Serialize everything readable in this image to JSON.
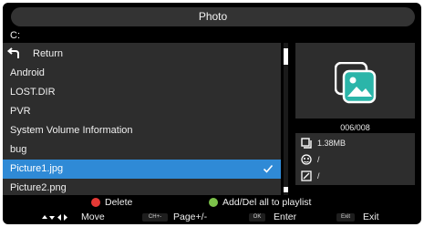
{
  "title": "Photo",
  "path": "C:",
  "file_list": {
    "return_label": "Return",
    "items": [
      {
        "label": "Android"
      },
      {
        "label": "LOST.DIR"
      },
      {
        "label": "PVR"
      },
      {
        "label": "System Volume Information"
      },
      {
        "label": "bug"
      },
      {
        "label": "Picture1.jpg",
        "selected": true
      },
      {
        "label": "Picture2.png"
      }
    ],
    "selected_index": 5
  },
  "preview": {
    "counter": "006/008",
    "file_size": "1.38MB",
    "resolution": "/",
    "date": "/"
  },
  "hints": {
    "delete_label": "Delete",
    "playlist_label": "Add/Del all to playlist"
  },
  "keys": {
    "move_label": "Move",
    "page_key": "CH+-",
    "page_label": "Page+/-",
    "ok_key": "OK",
    "enter_label": "Enter",
    "exit_key": "Exit",
    "exit_label": "Exit"
  },
  "colors": {
    "selection": "#2f8ad6",
    "delete_dot": "#e53935",
    "playlist_dot": "#7cc24a",
    "thumbnail_accent": "#2bb5a9"
  },
  "icons": {
    "return": "return-arrow-icon",
    "selected_mark": "checkmark-icon",
    "thumbnail": "photo-thumbnail-icon",
    "size": "file-size-icon",
    "resolution": "resolution-icon",
    "date": "date-icon"
  }
}
